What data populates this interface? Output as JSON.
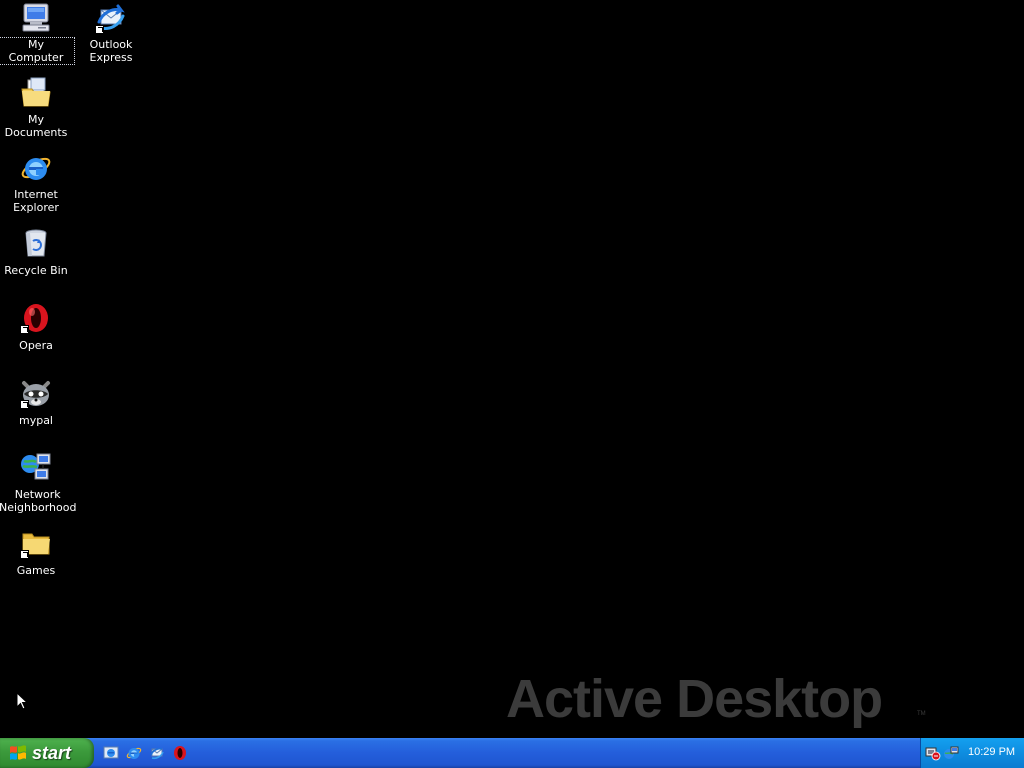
{
  "desktop": {
    "background": "#000000",
    "icons": [
      {
        "label": "My Computer",
        "icon": "my-computer-icon",
        "selected": true
      },
      {
        "label": "Outlook Express",
        "icon": "outlook-express-icon"
      },
      {
        "label": "My Documents",
        "icon": "my-documents-icon"
      },
      {
        "label": "Internet Explorer",
        "icon": "internet-explorer-icon"
      },
      {
        "label": "Recycle Bin",
        "icon": "recycle-bin-icon"
      },
      {
        "label": "Opera",
        "icon": "opera-icon"
      },
      {
        "label": "mypal",
        "icon": "mypal-raccoon-icon"
      },
      {
        "label": "Network Neighborhood",
        "icon": "network-neighborhood-icon"
      },
      {
        "label": "Games",
        "icon": "folder-icon"
      }
    ],
    "watermark": {
      "text": "Active Desktop",
      "tm": "TM"
    }
  },
  "taskbar": {
    "start_label": "start",
    "quick_launch": [
      {
        "name": "show-desktop",
        "icon": "show-desktop-icon"
      },
      {
        "name": "internet-explorer",
        "icon": "internet-explorer-icon"
      },
      {
        "name": "outlook-express",
        "icon": "outlook-express-icon"
      },
      {
        "name": "opera",
        "icon": "opera-icon"
      }
    ],
    "tray": {
      "icons": [
        "safely-remove-hardware-icon",
        "network-status-icon"
      ],
      "clock": "10:29 PM"
    }
  },
  "colors": {
    "taskbar": "#245edb",
    "start_button": "#3c9a3c",
    "tray": "#0e8de0",
    "watermark": "#3b3b3b"
  }
}
